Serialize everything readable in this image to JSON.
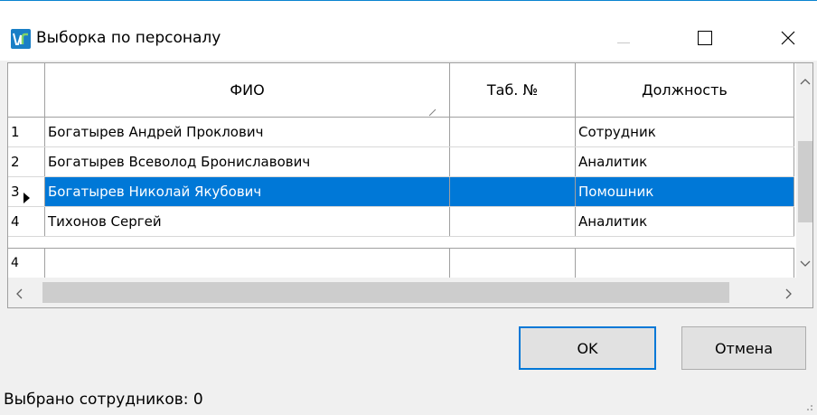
{
  "window": {
    "title": "Выборка по персоналу",
    "icon": "app-logo-icon",
    "controls": [
      "minimize-icon",
      "maximize-icon",
      "close-icon"
    ]
  },
  "grid": {
    "columns": [
      "ФИО",
      "Таб. №",
      "Должность"
    ],
    "sorted_column": "ФИО",
    "rows": [
      {
        "num": "1",
        "name": "Богатырев Андрей Проклович",
        "tab": "",
        "position": "Сотрудник",
        "selected": false
      },
      {
        "num": "2",
        "name": "Богатырев Всеволод Брониславович",
        "tab": "",
        "position": "Аналитик",
        "selected": false
      },
      {
        "num": "3",
        "name": "Богатырев Николай Якубович",
        "tab": "",
        "position": "Помошник",
        "selected": true
      },
      {
        "num": "4",
        "name": "Тихонов Сергей",
        "tab": "",
        "position": "Аналитик",
        "selected": false
      }
    ],
    "new_row_num": "4"
  },
  "buttons": {
    "ok_label": "OK",
    "cancel_label": "Отмена"
  },
  "status": {
    "text": "Выбрано сотрудников: 0"
  },
  "colors": {
    "selection": "#0078d7",
    "accent": "#0078d7",
    "window_border": "#0a84d0"
  }
}
